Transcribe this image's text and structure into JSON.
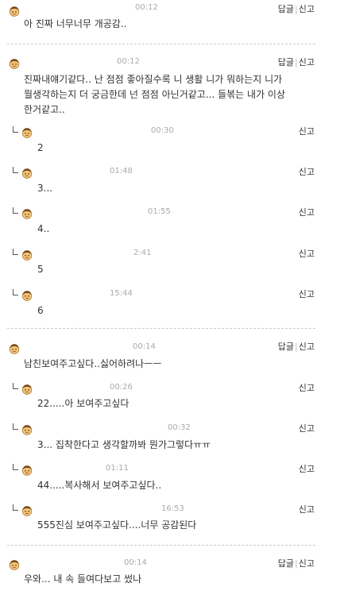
{
  "actions": {
    "reply": "답글",
    "report": "신고",
    "separator": "|"
  },
  "comments": [
    {
      "time": "00:12",
      "lines": [
        "아 진짜 너무너무 개공감.."
      ]
    },
    {
      "time": "00:12",
      "lines": [
        "진짜내얘기같다.. 난 점점 좋아질수록 니 생활 니가 뭐하는지 니가",
        "뭘생각하는지 더 궁금한데 넌 점점 아닌거같고... 들볶는 내가 이상",
        "한거같고.."
      ]
    },
    {
      "time": "00:30",
      "lines": [
        "2"
      ]
    },
    {
      "time": "01:48",
      "lines": [
        "3..."
      ]
    },
    {
      "time": "01:55",
      "lines": [
        "4.."
      ]
    },
    {
      "time": "2:41",
      "lines": [
        "5"
      ]
    },
    {
      "time": "15:44",
      "lines": [
        "6"
      ]
    },
    {
      "time": "00:14",
      "lines": [
        "남친보여주고싶다..싫어하려나ㅡㅡ"
      ]
    },
    {
      "time": "00:26",
      "lines": [
        "22.....아 보여주고싶다"
      ]
    },
    {
      "time": "00:32",
      "lines": [
        "3... 집착한다고 생각할까봐 뭔가그렇다ㅠㅠ"
      ]
    },
    {
      "time": "01:11",
      "lines": [
        "44.....복사해서 보여주고싶다.."
      ]
    },
    {
      "time": "16:53",
      "lines": [
        "555진심 보여주고싶다....너무 공감된다"
      ]
    },
    {
      "time": "00:14",
      "lines": [
        "우와... 내 속 들여다보고 썼나"
      ]
    }
  ]
}
